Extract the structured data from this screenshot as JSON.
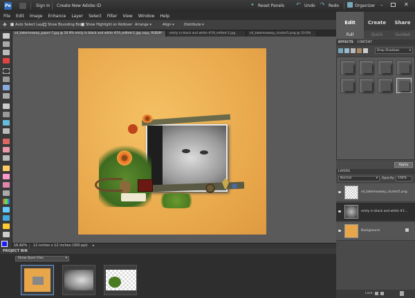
{
  "titlebar": {
    "sign_in": "Sign In",
    "create_id": "Create New Adobe ID",
    "reset_panels": "Reset Panels",
    "undo": "Undo",
    "redo": "Redo",
    "organizer": "Organizer"
  },
  "menu": [
    "File",
    "Edit",
    "Image",
    "Enhance",
    "Layer",
    "Select",
    "Filter",
    "View",
    "Window",
    "Help"
  ],
  "mode_tabs": [
    "Edit",
    "Create",
    "Share"
  ],
  "sub_tabs": [
    "Full",
    "Quick",
    "Guided"
  ],
  "options": {
    "auto_select": "Auto Select Layer",
    "bounding_box": "Show Bounding Box",
    "highlight": "Show Highlight on Rollover",
    "arrange": "Arrange",
    "align": "Align",
    "distribute": "Distribute"
  },
  "doc_tabs": [
    "sd_takemeaway_paper-7.jpg @ 16.9% emily in black and white #19_edited-1.jpg copy, RGB/8*",
    "emily in black and white #19_edited-1.jpg",
    "sd_takemeaway_cluster5.png @ 33.0%"
  ],
  "status": {
    "zoom": "16.92%",
    "size": "12 inches x 12 inches (300 ppi)"
  },
  "project_bin": {
    "title": "PROJECT BIN",
    "filter": "Show Open Files"
  },
  "effects": {
    "tabs": [
      "EFFECTS",
      "CONTENT"
    ],
    "category": "Drop Shadows",
    "apply": "Apply"
  },
  "layers": {
    "title": "LAYERS",
    "blend": "Normal",
    "opacity_label": "Opacity:",
    "opacity": "100%",
    "lock": "Lock:",
    "items": [
      {
        "name": "sd_takemeaway_cluster5.png"
      },
      {
        "name": "emily in black and white #1..."
      },
      {
        "name": "Background"
      }
    ]
  },
  "colors": {
    "accent": "#2e6bb8",
    "paper": "#e8a64a",
    "foreground": "#1a1aff",
    "background": "#ffffff"
  }
}
